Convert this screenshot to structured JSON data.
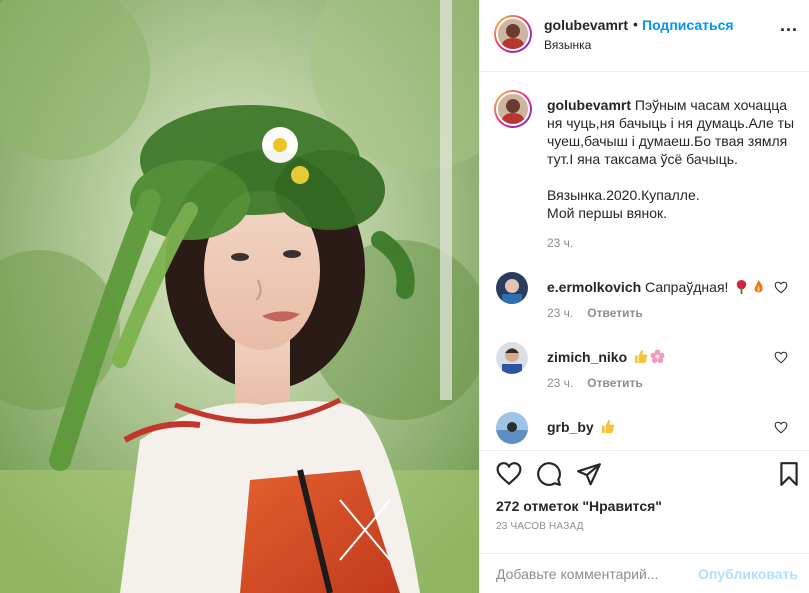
{
  "post": {
    "username": "golubevamrt",
    "dot": "•",
    "follow_label": "Подписаться",
    "location": "Вязынка",
    "more": "..."
  },
  "caption": {
    "username": "golubevamrt",
    "line1": "Пэўным часам хочацца ня чуць,ня бачыць і ня думаць.Але ты чуеш,бачыш і думаеш.Бо твая зямля тут.І яна таксама ўсё бачыць.",
    "line2": "Вязынка.2020.Купалле.",
    "line3": "Мой першы вянок.",
    "time": "23 ч."
  },
  "comments": [
    {
      "username": "e.ermolkovich",
      "text": "Сапраўдная!",
      "emoji": [
        "rose-icon",
        "fire-icon"
      ],
      "time": "23 ч.",
      "reply": "Ответить"
    },
    {
      "username": "zimich_niko",
      "text": "",
      "emoji": [
        "thumbs-up-icon",
        "blossom-icon"
      ],
      "time": "23 ч.",
      "reply": "Ответить"
    },
    {
      "username": "grb_by",
      "text": "",
      "emoji": [
        "thumbs-up-icon"
      ],
      "time": "",
      "reply": ""
    }
  ],
  "likes_text": "272 отметок \"Нравится\"",
  "posted_ago": "23 ЧАСОВ НАЗАД",
  "add_comment": {
    "placeholder": "Добавьте комментарий...",
    "publish_label": "Опубликовать"
  },
  "colors": {
    "link_blue": "#0095f6",
    "publish_disabled": "#b2dffc",
    "muted": "#8e8e8e",
    "border": "#efefef"
  }
}
